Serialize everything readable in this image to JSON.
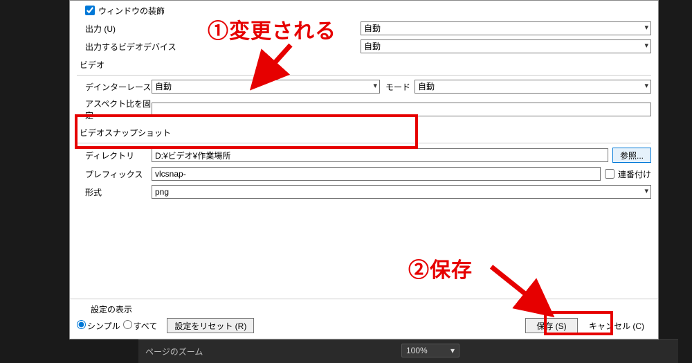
{
  "top": {
    "window_decoration_label": "ウィンドウの装飾",
    "window_decoration_checked": true,
    "output_label": "出力 (U)",
    "output_value": "自動",
    "video_device_label": "出力するビデオデバイス",
    "video_device_value": "自動"
  },
  "video": {
    "section_title": "ビデオ",
    "deinterlace_label": "デインターレース",
    "deinterlace_value": "自動",
    "mode_label": "モード",
    "mode_value": "自動",
    "aspect_label": "アスペクト比を固定",
    "aspect_value": ""
  },
  "snapshot": {
    "section_title": "ビデオスナップショット",
    "directory_label": "ディレクトリ",
    "directory_value": "D:¥ビデオ¥作業場所",
    "browse_label": "参照...",
    "prefix_label": "プレフィックス",
    "prefix_value": "vlcsnap-",
    "sequential_label": "連番付け",
    "sequential_checked": false,
    "format_label": "形式",
    "format_value": "png"
  },
  "footer": {
    "show_settings_label": "設定の表示",
    "simple_label": "シンプル",
    "all_label": "すべて",
    "reset_label": "設定をリセット (R)",
    "save_label": "保存 (S)",
    "cancel_label": "キャンセル (C)"
  },
  "annotations": {
    "a1": "①変更される",
    "a2": "②保存"
  },
  "background": {
    "zoom_label": "ページのズーム",
    "zoom_value": "100%"
  }
}
